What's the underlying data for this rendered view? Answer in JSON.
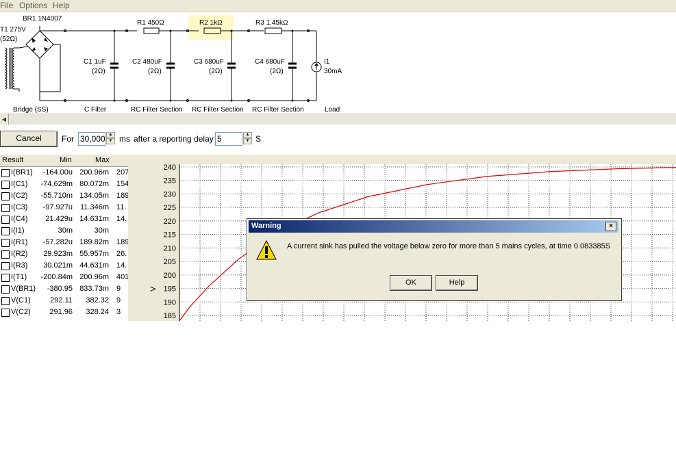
{
  "menu": [
    "File",
    "Options",
    "Help"
  ],
  "schematic": {
    "transformer": [
      "T1 275V",
      "(52Ω)"
    ],
    "bridge": "BR1 1N4007",
    "components": [
      {
        "name": "C1 1uF",
        "esr": "(2Ω)"
      },
      {
        "name": "C2 480uF",
        "esr": "(2Ω)"
      },
      {
        "name": "C3 680uF",
        "esr": "(2Ω)"
      },
      {
        "name": "C4 680uF",
        "esr": "(2Ω)"
      }
    ],
    "resistors": [
      "R1 450Ω",
      "R2 1kΩ",
      "R3 1.45kΩ"
    ],
    "load": [
      "I1",
      "30mA"
    ],
    "sections": [
      "Bridge (SS)",
      "C Filter",
      "RC Filter Section",
      "RC Filter Section",
      "RC Filter Section",
      "Load"
    ],
    "highlight_color": "#fff9c8"
  },
  "toolbar": {
    "cancel_label": "Cancel",
    "for_label": "For",
    "duration_value": "30,000",
    "duration_unit": "ms",
    "delay_label": "after a reporting delay of",
    "delay_value": "5",
    "delay_unit": "S"
  },
  "results": {
    "headers": [
      "Result",
      "Min",
      "Max"
    ],
    "rows": [
      {
        "name": "I(BR1)",
        "min": "-164.00u",
        "max": "200.96m",
        "extra": "207"
      },
      {
        "name": "I(C1)",
        "min": "-74.629m",
        "max": "80.072m",
        "extra": "154"
      },
      {
        "name": "I(C2)",
        "min": "-55.710m",
        "max": "134.05m",
        "extra": "189"
      },
      {
        "name": "I(C3)",
        "min": "-97.927u",
        "max": "11.346m",
        "extra": "11."
      },
      {
        "name": "I(C4)",
        "min": "21.429u",
        "max": "14.631m",
        "extra": "14."
      },
      {
        "name": "I(I1)",
        "min": "30m",
        "max": "30m",
        "extra": ""
      },
      {
        "name": "I(R1)",
        "min": "-57.282u",
        "max": "189.82m",
        "extra": "189"
      },
      {
        "name": "I(R2)",
        "min": "29.923m",
        "max": "55.957m",
        "extra": "26."
      },
      {
        "name": "I(R3)",
        "min": "30.021m",
        "max": "44.631m",
        "extra": "14."
      },
      {
        "name": "I(T1)",
        "min": "-200.84m",
        "max": "200.96m",
        "extra": "401"
      },
      {
        "name": "V(BR1)",
        "min": "-380.95",
        "max": "833.73m",
        "extra": "9"
      },
      {
        "name": "V(C1)",
        "min": "292.11",
        "max": "382.32",
        "extra": "9"
      },
      {
        "name": "V(C2)",
        "min": "291.96",
        "max": "328.24",
        "extra": "3"
      }
    ]
  },
  "chart_data": {
    "type": "line",
    "ylabel": "V",
    "yticks": [
      185,
      190,
      195,
      200,
      205,
      210,
      215,
      220,
      225,
      230,
      235,
      240
    ],
    "ylim": [
      183,
      241
    ],
    "grid": true,
    "series": [
      {
        "color": "#dd0000",
        "points": [
          [
            0.0,
            183
          ],
          [
            0.02,
            188
          ],
          [
            0.06,
            196
          ],
          [
            0.12,
            206
          ],
          [
            0.2,
            216
          ],
          [
            0.28,
            223
          ],
          [
            0.38,
            229
          ],
          [
            0.5,
            233.5
          ],
          [
            0.62,
            236.5
          ],
          [
            0.75,
            238.3
          ],
          [
            0.88,
            239.3
          ],
          [
            1.0,
            239.8
          ]
        ]
      }
    ]
  },
  "dialog": {
    "title": "Warning",
    "message": "A current sink has pulled the voltage below zero for more than 5 mains cycles, at time 0.083385S",
    "ok_label": "OK",
    "help_label": "Help",
    "close_glyph": "×"
  }
}
